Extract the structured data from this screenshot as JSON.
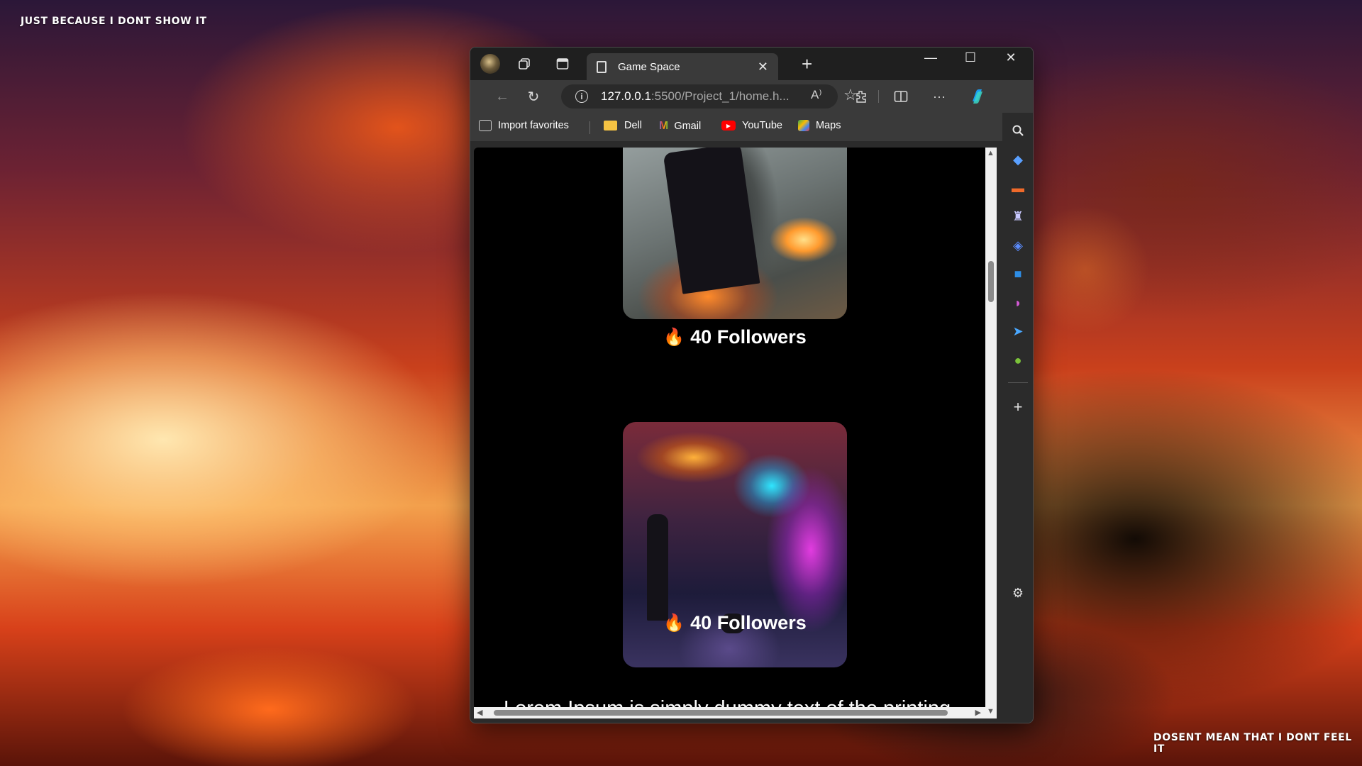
{
  "wallpaper": {
    "top_text": "JUST BECAUSE I DONT SHOW IT",
    "bottom_text": "DOSENT MEAN THAT I DONT FEEL IT"
  },
  "browser": {
    "tab": {
      "title": "Game Space"
    },
    "address": {
      "url_host": "127.0.0.1",
      "url_rest": ":5500/Project_1/home.h...",
      "read_aloud": "A⁾"
    },
    "bookmarks": [
      {
        "label": "Import favorites",
        "icon": "import-icon"
      },
      {
        "label": "Dell",
        "icon": "folder-icon"
      },
      {
        "label": "Gmail",
        "icon": "gmail-icon"
      },
      {
        "label": "YouTube",
        "icon": "youtube-icon"
      },
      {
        "label": "Maps",
        "icon": "maps-icon"
      }
    ]
  },
  "page": {
    "cards": [
      {
        "followers": "40 Followers",
        "image": "armored-soldier-firing"
      },
      {
        "followers": "40 Followers",
        "image": "neon-city-street"
      }
    ],
    "lorem_text": "Lorem Ipsum is simply dummy text of the printing"
  },
  "sidebar": {
    "icons": [
      "search-icon",
      "shopping-tag-icon",
      "tools-icon",
      "games-icon",
      "copilot-icon",
      "outlook-icon",
      "designer-icon",
      "telegram-icon",
      "tree-icon",
      "add-icon",
      "settings-icon"
    ]
  },
  "colors": {
    "accent": "#1a73e8",
    "page_bg": "#000000",
    "chrome_dark": "#1f1f1f",
    "chrome": "#3a3a3a"
  }
}
